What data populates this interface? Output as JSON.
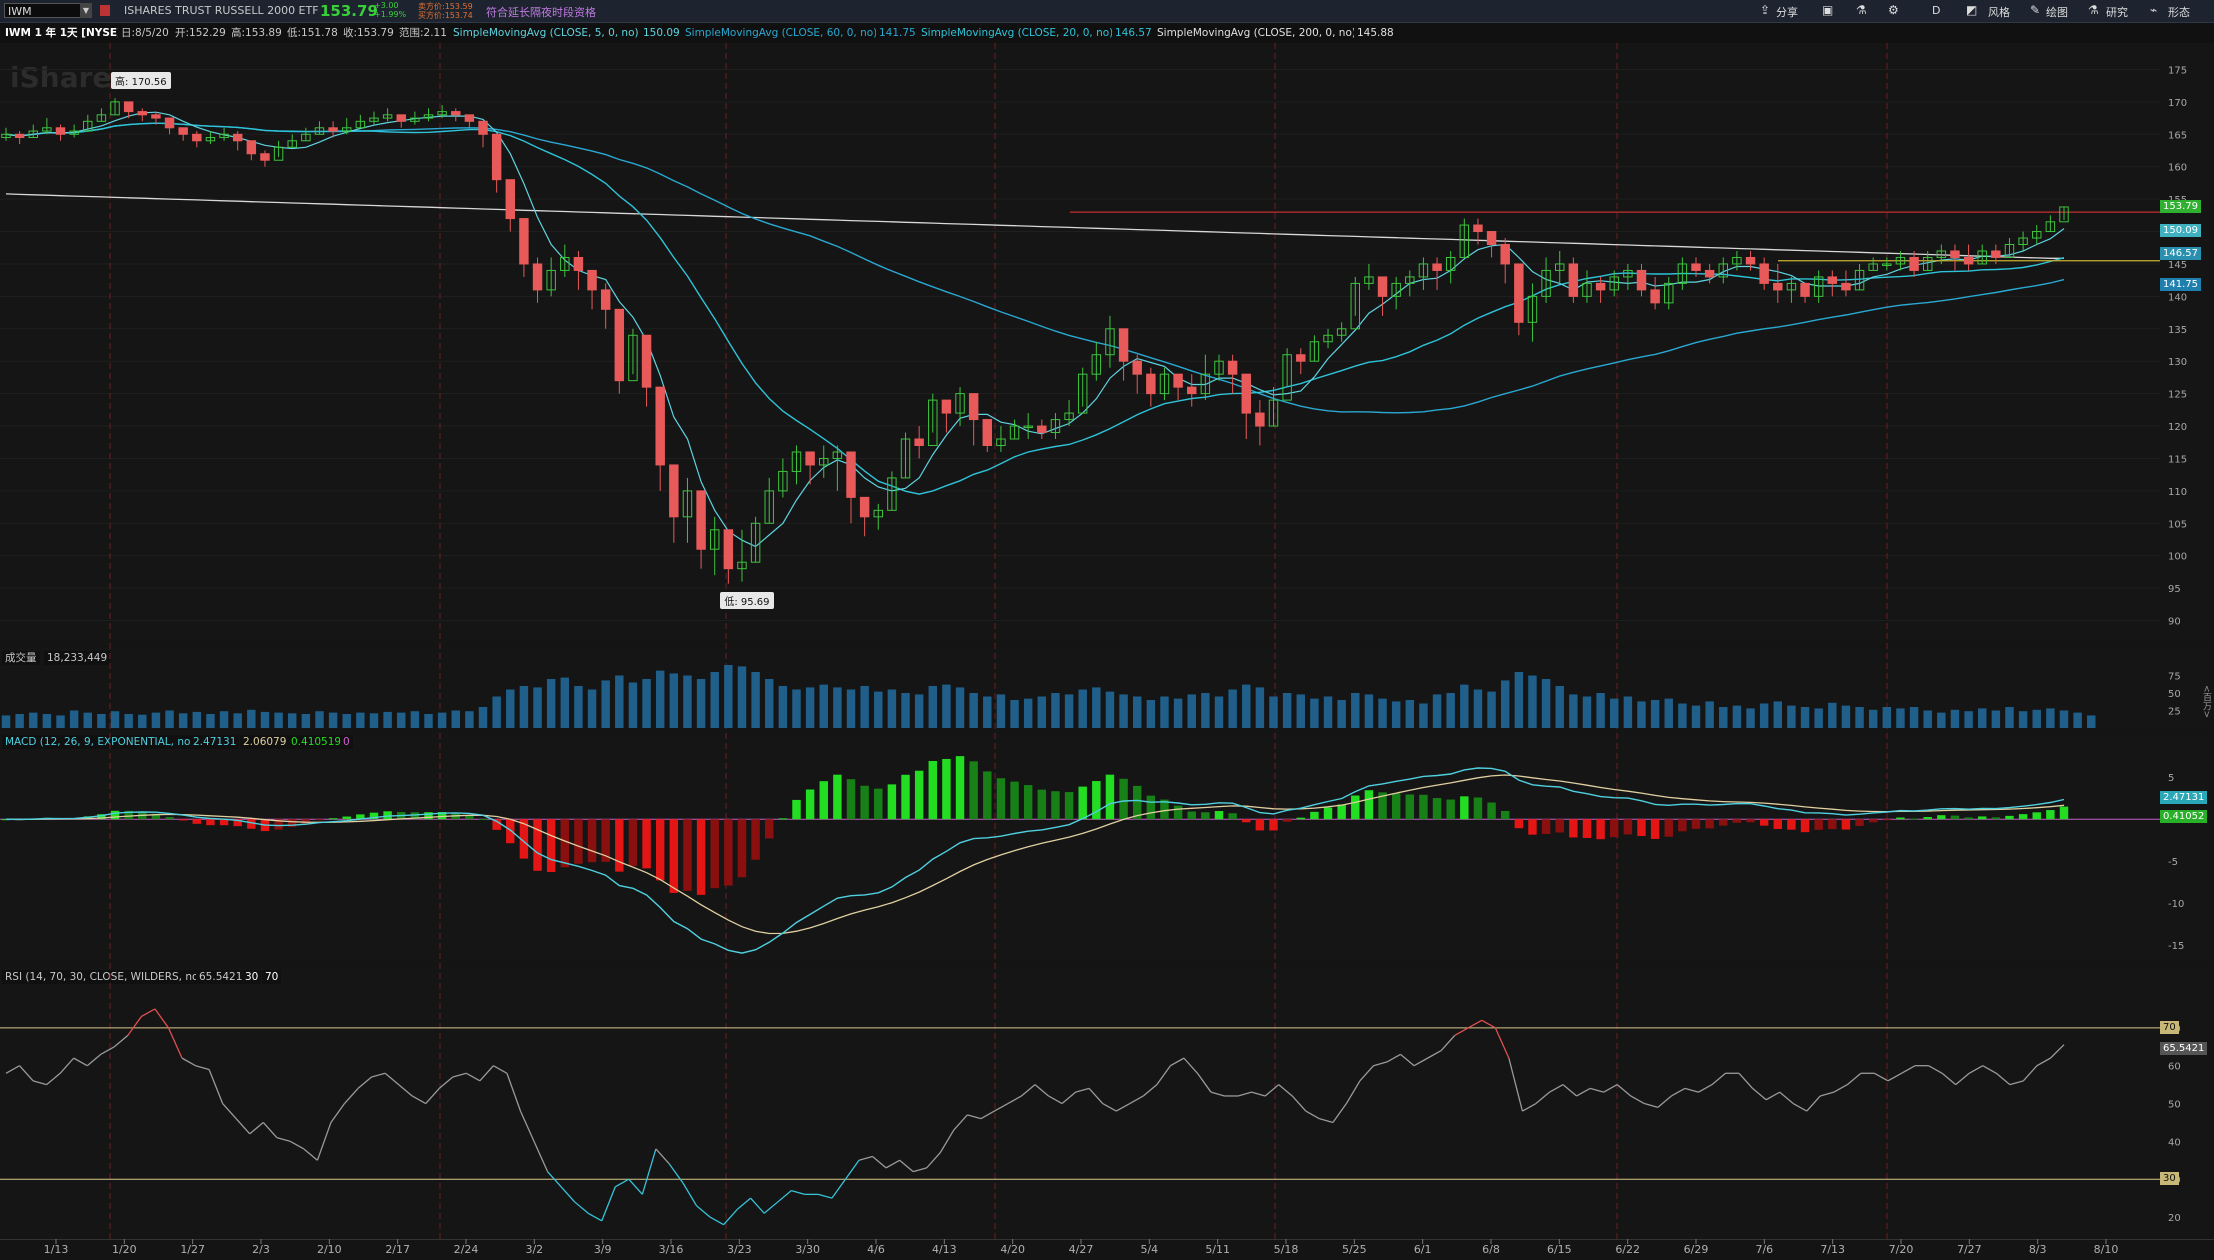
{
  "toolbar": {
    "symbol": "IWM",
    "description": "ISHARES TRUST RUSSELL 2000 ETF",
    "last": "153.79",
    "change": "+3.00",
    "change_pct": "+1.99%",
    "bid": "卖方价:153.59",
    "ask": "买方价:153.74",
    "notice": "符合延长隔夜时段资格",
    "buttons": [
      "分享",
      "D",
      "风格",
      "绘图",
      "研究",
      "形态"
    ]
  },
  "info": {
    "title": "IWM 1 年 1天 [NYSE]",
    "date": "日:8/5/20",
    "open": "开:152.29",
    "high": "高:153.89",
    "low": "低:151.78",
    "close": "收:153.79",
    "range": "范围:2.11",
    "sma5": "SimpleMovingAvg (CLOSE, 5, 0, no)",
    "sma5v": "150.09",
    "sma60": "SimpleMovingAvg (CLOSE, 60, 0, no)",
    "sma60v": "141.75",
    "sma20": "SimpleMovingAvg (CLOSE, 20, 0, no)",
    "sma20v": "146.57",
    "sma200": "SimpleMovingAvg (CLOSE, 200, 0, no)",
    "sma200v": "145.88"
  },
  "watermark": "iShares",
  "high_label": "高: 170.56",
  "low_label": "低: 95.69",
  "volume": {
    "label": "成交量",
    "value": "18,233,449",
    "axis_title": "<百万>"
  },
  "macd": {
    "label": "MACD (12, 26, 9, EXPONENTIAL, no)",
    "v1": "2.47131",
    "v2": "2.06079",
    "v3": "0.410519",
    "v4": "0"
  },
  "rsi": {
    "label": "RSI (14, 70, 30, CLOSE, WILDERS, no)",
    "v1": "65.5421",
    "v2": "30",
    "v3": "70"
  },
  "badges": {
    "price": "153.79",
    "sma5": "150.09",
    "sma20": "146.57",
    "sma60": "141.75",
    "macd": "2.47131",
    "macd_diff": "0.41052",
    "rsi": "65.5421",
    "rsi70": "70",
    "rsi30": "30"
  },
  "colors": {
    "up": "#3ec33e",
    "down": "#e85a5a",
    "sma5": "#5fd3e0",
    "sma20": "#2ec3d8",
    "sma60": "#2aa8d2",
    "sma200": "#d8d8d8",
    "volume": "#1f5f8a",
    "macd": "#4fd0e0",
    "signal": "#e0cfa0",
    "hist_up": "#22dd22",
    "hist_down": "#e31515",
    "rsi": "#9a9a9a",
    "resistance": "#c33030",
    "support": "#c8b030"
  },
  "chart_data": [
    {
      "type": "candlestick",
      "title": "IWM 1 年 1天 [NYSE]",
      "ylim": [
        87,
        178
      ],
      "yticks": [
        90,
        95,
        100,
        105,
        110,
        115,
        120,
        125,
        130,
        135,
        140,
        145,
        150,
        155,
        160,
        165,
        170,
        175
      ],
      "x_tick_labels": [
        "1/13",
        "1/20",
        "1/27",
        "2/3",
        "2/10",
        "2/17",
        "2/24",
        "3/2",
        "3/9",
        "3/16",
        "3/23",
        "3/30",
        "4/6",
        "4/13",
        "4/20",
        "4/27",
        "5/4",
        "5/11",
        "5/18",
        "5/25",
        "6/1",
        "6/8",
        "6/15",
        "6/22",
        "6/29",
        "7/6",
        "7/13",
        "7/20",
        "7/27",
        "8/3",
        "8/10"
      ],
      "close": [
        165,
        164.5,
        165.5,
        166,
        165,
        165.5,
        167,
        168,
        170,
        168.5,
        168,
        167.5,
        166,
        165,
        164,
        164.5,
        165,
        164,
        162,
        161,
        163,
        164,
        165,
        166,
        165.5,
        166,
        167,
        167.5,
        168,
        167,
        167.5,
        168,
        168.5,
        168,
        167,
        165,
        158,
        152,
        145,
        141,
        144,
        146,
        144,
        141,
        138,
        127,
        134,
        126,
        114,
        106,
        110,
        101,
        104,
        98,
        99,
        105,
        110,
        113,
        116,
        114,
        115,
        116,
        109,
        106,
        107,
        112,
        118,
        117,
        124,
        122,
        125,
        121,
        117,
        118,
        120,
        120,
        119,
        121,
        122,
        128,
        131,
        135,
        130,
        128,
        125,
        128,
        126,
        125,
        128,
        130,
        128,
        122,
        120,
        124,
        131,
        130,
        133,
        134,
        135,
        142,
        143,
        140,
        142,
        143,
        145,
        144,
        146,
        151,
        150,
        148,
        145,
        136,
        140,
        144,
        145,
        140,
        142,
        141,
        143,
        144,
        141,
        139,
        142,
        145,
        144,
        143,
        145,
        146,
        145,
        142,
        141,
        142,
        140,
        143,
        142,
        141,
        144,
        145,
        145,
        146,
        144,
        146,
        147,
        146,
        145,
        147,
        146,
        148,
        149,
        150,
        151.5,
        153.79
      ],
      "high": [
        166,
        165.5,
        166.5,
        167.5,
        166.5,
        166.5,
        168,
        169,
        170.56,
        169.5,
        169,
        168.5,
        167.5,
        166,
        165.5,
        165.5,
        166,
        165.5,
        163.5,
        162.5,
        164,
        165,
        166,
        167,
        167,
        167.5,
        168,
        168.5,
        169,
        168,
        168.5,
        169,
        169.5,
        169,
        168,
        167,
        164,
        158,
        152,
        146,
        146,
        148,
        147,
        144,
        142,
        135,
        135,
        134,
        120,
        112,
        112,
        108,
        106,
        103,
        104,
        106,
        112,
        115,
        117,
        116,
        117,
        117,
        113,
        109,
        108,
        113,
        119,
        120,
        125,
        124,
        126,
        124,
        119,
        120,
        121,
        122,
        121,
        122,
        124,
        129,
        133,
        137,
        134,
        131,
        129,
        129,
        128,
        128,
        131,
        131,
        131,
        128,
        124,
        126,
        132,
        132,
        134,
        135,
        136,
        143,
        145,
        143,
        143,
        144,
        146,
        146,
        147,
        152,
        152,
        150,
        149,
        144,
        142,
        146,
        147,
        146,
        144,
        143,
        144,
        145,
        145,
        143,
        143,
        146,
        146,
        145,
        146,
        147,
        147,
        146,
        145,
        143,
        142,
        144,
        144,
        144,
        145,
        146,
        146,
        147,
        147,
        147,
        148,
        148,
        148,
        148,
        148,
        149,
        150,
        151,
        152.5,
        153.89
      ],
      "low": [
        164,
        163.5,
        164.5,
        165,
        164,
        164.5,
        165.5,
        167,
        168,
        167.5,
        167,
        166.5,
        165,
        164,
        163,
        163.5,
        164,
        162.5,
        161,
        160,
        161.5,
        163,
        164,
        165,
        164.5,
        165,
        166,
        166.5,
        167,
        166,
        166.5,
        167,
        167.5,
        167,
        166,
        163,
        156,
        150,
        143,
        139,
        140,
        143,
        141,
        138,
        135,
        125,
        128,
        123,
        110,
        102,
        102,
        98,
        97,
        95.69,
        96,
        99,
        105,
        109,
        111,
        111,
        112,
        110,
        105,
        103,
        104,
        107,
        112,
        115,
        119,
        119,
        120,
        117,
        116,
        116,
        118,
        118,
        118,
        118,
        120,
        123,
        127,
        129,
        127,
        125,
        123,
        124,
        124,
        123,
        124,
        127,
        125,
        118,
        117,
        120,
        126,
        128,
        130,
        132,
        133,
        137,
        141,
        137,
        138,
        140,
        141,
        141,
        142,
        146,
        148,
        146,
        142,
        134,
        133,
        139,
        142,
        139,
        139,
        139,
        140,
        141,
        140,
        138,
        138,
        141,
        143,
        142,
        142,
        144,
        144,
        141,
        139,
        139,
        139,
        139,
        140,
        140,
        141,
        144,
        144,
        144,
        143,
        144,
        145,
        144,
        144,
        145,
        145,
        146,
        147,
        148,
        150,
        151.78
      ],
      "sma5_last": 150.09,
      "sma20_last": 146.57,
      "sma60_last": 141.75,
      "sma200_last": 145.88,
      "resistance": 153,
      "support": 145.5,
      "price_last": 153.79
    },
    {
      "type": "bar",
      "title": "成交量",
      "ylim": [
        0,
        90
      ],
      "yticks": [
        25,
        50,
        75
      ],
      "values": [
        18,
        20,
        22,
        20,
        18,
        25,
        22,
        20,
        24,
        20,
        19,
        22,
        25,
        21,
        23,
        20,
        24,
        21,
        26,
        23,
        22,
        21,
        20,
        24,
        22,
        20,
        22,
        21,
        23,
        22,
        24,
        20,
        22,
        25,
        24,
        30,
        45,
        55,
        60,
        58,
        70,
        72,
        60,
        55,
        68,
        75,
        65,
        70,
        82,
        78,
        75,
        70,
        80,
        90,
        88,
        80,
        70,
        60,
        55,
        58,
        62,
        58,
        55,
        60,
        52,
        55,
        50,
        48,
        60,
        62,
        58,
        50,
        45,
        48,
        40,
        42,
        45,
        50,
        48,
        55,
        58,
        52,
        48,
        45,
        40,
        45,
        42,
        48,
        50,
        45,
        55,
        62,
        58,
        45,
        50,
        48,
        42,
        45,
        40,
        50,
        48,
        42,
        38,
        40,
        35,
        48,
        50,
        62,
        55,
        52,
        68,
        80,
        75,
        70,
        60,
        48,
        45,
        50,
        42,
        45,
        38,
        40,
        42,
        35,
        32,
        38,
        30,
        32,
        28,
        35,
        38,
        32,
        30,
        28,
        36,
        32,
        30,
        26,
        30,
        28,
        30,
        25,
        22,
        26,
        24,
        28,
        25,
        30,
        24,
        26,
        28,
        25,
        22,
        18
      ]
    },
    {
      "type": "line",
      "title": "MACD (12, 26, 9, EXPONENTIAL, no)",
      "ylim": [
        -17,
        8
      ],
      "yticks": [
        5,
        0,
        -5,
        -10,
        -15
      ],
      "macd_last": 2.47131,
      "signal_last": 2.06079,
      "diff_last": 0.410519
    },
    {
      "type": "line",
      "title": "RSI (14, 70, 30, CLOSE, WILDERS, no)",
      "ylim": [
        15,
        80
      ],
      "yticks": [
        20,
        30,
        40,
        50,
        60,
        70
      ],
      "values": [
        58,
        60,
        56,
        55,
        58,
        62,
        60,
        63,
        65,
        68,
        73,
        75,
        70,
        62,
        60,
        59,
        50,
        46,
        42,
        45,
        41,
        40,
        38,
        35,
        45,
        50,
        54,
        57,
        58,
        55,
        52,
        50,
        54,
        57,
        58,
        56,
        60,
        58,
        48,
        40,
        32,
        28,
        24,
        21,
        19,
        28,
        30,
        26,
        38,
        34,
        29,
        23,
        20,
        18,
        22,
        25,
        21,
        24,
        27,
        26,
        26,
        25,
        30,
        35,
        36,
        33,
        35,
        32,
        33,
        37,
        43,
        47,
        46,
        48,
        50,
        52,
        55,
        52,
        50,
        53,
        54,
        50,
        48,
        50,
        52,
        55,
        60,
        62,
        58,
        53,
        52,
        52,
        53,
        52,
        55,
        52,
        48,
        46,
        45,
        50,
        56,
        60,
        61,
        63,
        60,
        62,
        64,
        68,
        70,
        72,
        70,
        62,
        48,
        50,
        53,
        55,
        52,
        54,
        53,
        55,
        52,
        50,
        49,
        52,
        54,
        53,
        55,
        58,
        58,
        54,
        51,
        53,
        50,
        48,
        52,
        53,
        55,
        58,
        58,
        56,
        58,
        60,
        60,
        58,
        55,
        58,
        60,
        58,
        55,
        56,
        60,
        62,
        65.5421
      ],
      "overbought": 70,
      "oversold": 30
    }
  ]
}
